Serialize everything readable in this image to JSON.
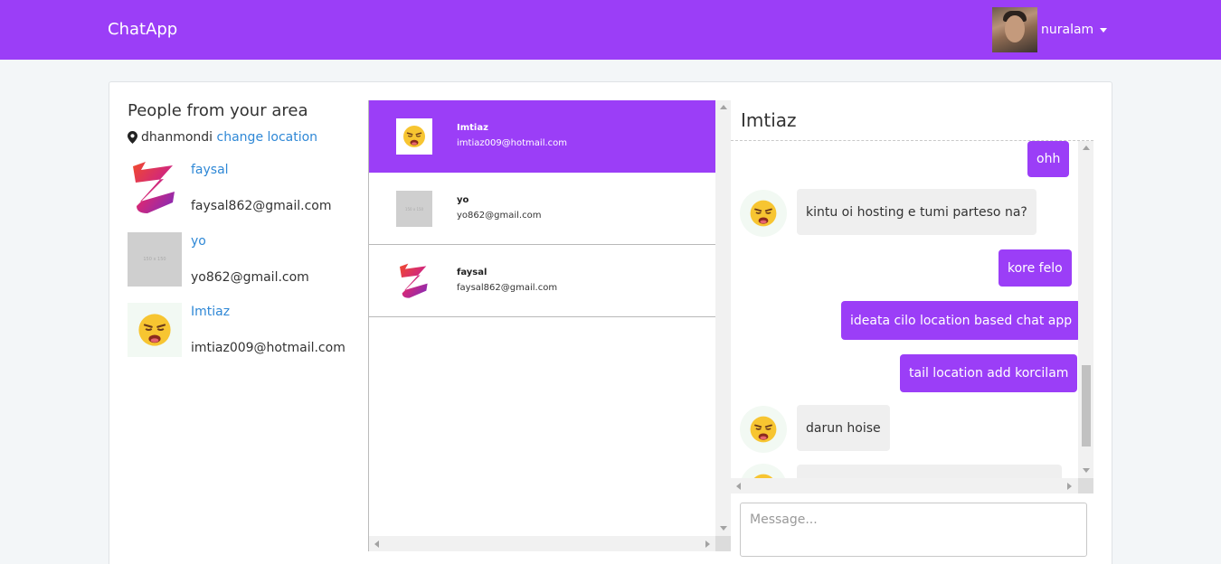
{
  "navbar": {
    "brand": "ChatApp",
    "user_name": "nuralam"
  },
  "people": {
    "title": "People from your area",
    "location_name": "dhanmondi",
    "change_location_label": "change location",
    "items": [
      {
        "name": "faysal",
        "email": "faysal862@gmail.com",
        "avatar": "z-logo"
      },
      {
        "name": "yo",
        "email": "yo862@gmail.com",
        "avatar": "placeholder",
        "placeholder_text": "150 x 150"
      },
      {
        "name": "Imtiaz",
        "email": "imtiaz009@hotmail.com",
        "avatar": "emoji"
      }
    ]
  },
  "contacts": [
    {
      "name": "Imtiaz",
      "email": "imtiaz009@hotmail.com",
      "active": true
    },
    {
      "name": "yo",
      "email": "yo862@gmail.com",
      "placeholder_text": "150 x 150"
    },
    {
      "name": "faysal",
      "email": "faysal862@gmail.com"
    }
  ],
  "chat": {
    "title": "Imtiaz",
    "messages": [
      {
        "from": "me",
        "text": "ohh"
      },
      {
        "from": "them",
        "text": "kintu oi hosting e tumi parteso na?"
      },
      {
        "from": "me",
        "text": "kore felo"
      },
      {
        "from": "me",
        "text": "ideata cilo location based chat app"
      },
      {
        "from": "me",
        "text": "tail location add korcilam"
      },
      {
        "from": "them",
        "text": "darun hoise"
      }
    ],
    "input_placeholder": "Message..."
  },
  "colors": {
    "accent": "#9b3ef7",
    "link": "#2f88d6"
  }
}
